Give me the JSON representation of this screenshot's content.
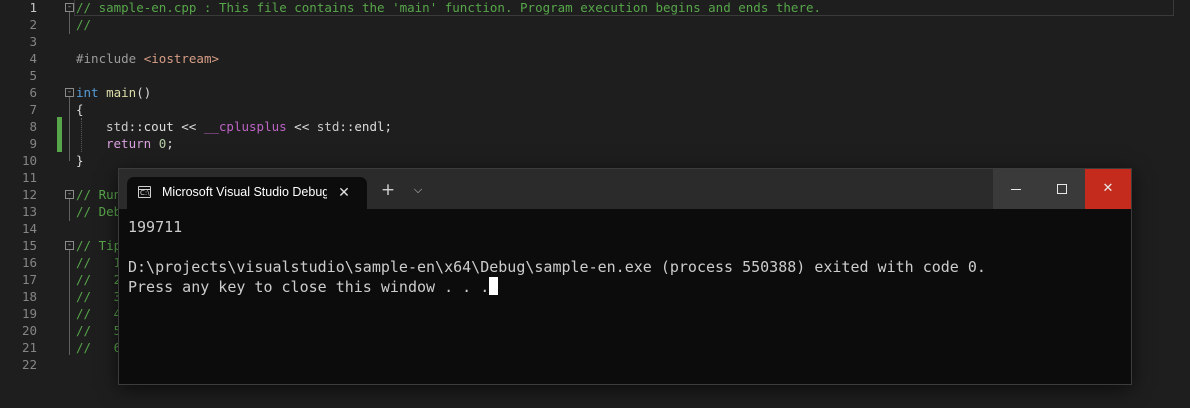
{
  "editor": {
    "line_numbers": [
      "1",
      "2",
      "3",
      "4",
      "5",
      "6",
      "7",
      "8",
      "9",
      "10",
      "11",
      "12",
      "13",
      "14",
      "15",
      "16",
      "17",
      "18",
      "19",
      "20",
      "21",
      "22"
    ],
    "lines": {
      "l1": "// sample-en.cpp : This file contains the 'main' function. Program execution begins and ends there.",
      "l2": "//",
      "l4_directive": "#include",
      "l4_header": "<iostream>",
      "l6_kw": "int",
      "l6_fn": "main",
      "l6_paren": "()",
      "l7": "{",
      "l8_std1": "std",
      "l8_sep1": "::",
      "l8_cout": "cout",
      "l8_op1": " << ",
      "l8_macro": "__cplusplus",
      "l8_op2": " << ",
      "l8_std2": "std",
      "l8_sep2": "::",
      "l8_endl": "endl",
      "l8_end": ";",
      "l9_kw": "return",
      "l9_num": "0",
      "l9_end": ";",
      "l10": "}",
      "l12": "// Run",
      "l13": "// Deb",
      "l15": "// Tip",
      "l16": "//   1",
      "l17": "//   2",
      "l18": "//   3",
      "l19": "//   4",
      "l20": "//   5",
      "l21": "//   6"
    }
  },
  "terminal": {
    "tab_title": "Microsoft Visual Studio Debug Console",
    "tab_icon": "terminal-icon",
    "close_glyph": "✕",
    "new_tab_glyph": "+",
    "dropdown_glyph": "⌵",
    "close_window_glyph": "✕",
    "output": [
      "199711",
      "",
      "D:\\projects\\visualstudio\\sample-en\\x64\\Debug\\sample-en.exe (process 550388) exited with code 0.",
      "Press any key to close this window . . ."
    ]
  },
  "colors": {
    "editor_bg": "#1e1e1e",
    "comment": "#57a64a",
    "keyword": "#569cd6",
    "terminal_bg": "#0c0c0c",
    "close_button": "#c42b1c"
  }
}
